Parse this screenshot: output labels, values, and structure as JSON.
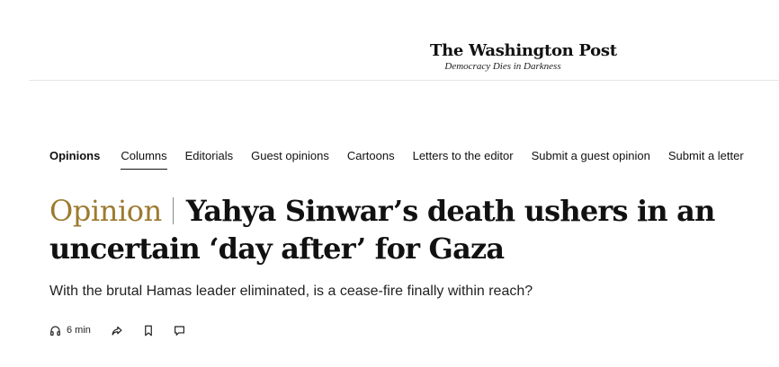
{
  "masthead": {
    "brand": "The Washington Post",
    "tagline": "Democracy Dies in Darkness"
  },
  "subnav": {
    "items": [
      {
        "label": "Opinions"
      },
      {
        "label": "Columns"
      },
      {
        "label": "Editorials"
      },
      {
        "label": "Guest opinions"
      },
      {
        "label": "Cartoons"
      },
      {
        "label": "Letters to the editor"
      },
      {
        "label": "Submit a guest opinion"
      },
      {
        "label": "Submit a letter"
      }
    ],
    "active": "Columns"
  },
  "article": {
    "kicker": "Opinion",
    "headline": "Yahya Sinwar’s death ushers in an uncertain ‘day after’ for Gaza",
    "subhead": "With the brutal Hamas leader eliminated, is a cease-fire finally within reach?"
  },
  "tools": {
    "listen_duration": "6 min",
    "icons": [
      "headphones-icon",
      "share-icon",
      "bookmark-icon",
      "comment-icon"
    ]
  },
  "colors": {
    "kicker": "#9c7a2f",
    "text": "#111111",
    "divider": "#e6e6e6"
  }
}
